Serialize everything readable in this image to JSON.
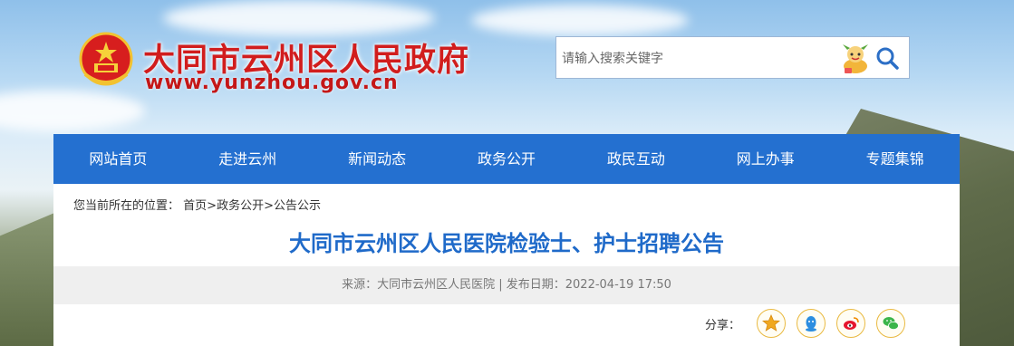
{
  "header": {
    "site_title": "大同市云州区人民政府",
    "site_url": "www.yunzhou.gov.cn"
  },
  "search": {
    "placeholder": "请输入搜索关键字",
    "button_icon": "search-icon",
    "mascot_icon": "mascot-icon"
  },
  "nav": {
    "items": [
      {
        "label": "网站首页"
      },
      {
        "label": "走进云州"
      },
      {
        "label": "新闻动态"
      },
      {
        "label": "政务公开"
      },
      {
        "label": "政民互动"
      },
      {
        "label": "网上办事"
      },
      {
        "label": "专题集锦"
      }
    ]
  },
  "breadcrumb": {
    "prefix": "您当前所在的位置：",
    "items": [
      "首页",
      "政务公开",
      "公告公示"
    ],
    "separator": ">"
  },
  "article": {
    "title": "大同市云州区人民医院检验士、护士招聘公告",
    "source_label": "来源：",
    "source": "大同市云州区人民医院",
    "divider": " | ",
    "date_label": "发布日期：",
    "date": "2022-04-19 17:50"
  },
  "share": {
    "label": "分享：",
    "buttons": [
      "favorite-star-icon",
      "qq-icon",
      "weibo-icon",
      "wechat-icon"
    ]
  },
  "colors": {
    "nav_bg": "#2470d0",
    "title_blue": "#1f6ac9",
    "brand_red": "#d11d1d",
    "share_ring": "#e9b940"
  }
}
